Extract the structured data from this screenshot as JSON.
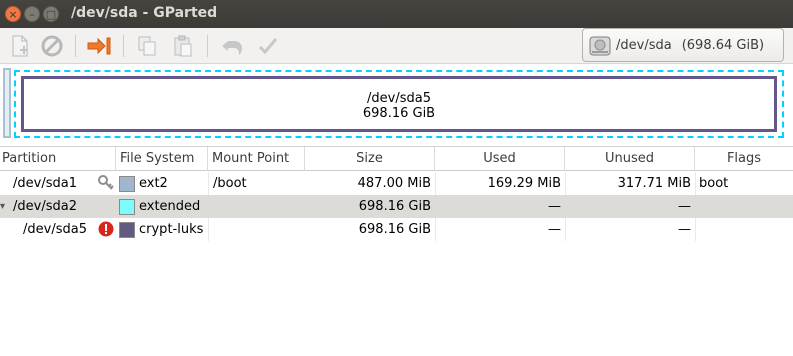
{
  "window": {
    "title": "/dev/sda - GParted"
  },
  "titlebar_buttons": {
    "close": "×",
    "minimize": "–",
    "maximize": "□"
  },
  "toolbar": {
    "icons": [
      "new-partition-icon",
      "delete-icon",
      "resize-move-icon",
      "copy-icon",
      "paste-icon",
      "undo-icon",
      "apply-icon"
    ],
    "device": "/dev/sda",
    "device_size": "(698.64 GiB)"
  },
  "partition_map": {
    "name": "/dev/sda5",
    "size": "698.16 GiB"
  },
  "table": {
    "columns": [
      "Partition",
      "File System",
      "Mount Point",
      "Size",
      "Used",
      "Unused",
      "Flags"
    ],
    "rows": [
      {
        "partition": "/dev/sda1",
        "indicator": "key-icon",
        "fs": "ext2",
        "fs_color": "#9fb6cd",
        "mount": "/boot",
        "size": "487.00 MiB",
        "used": "169.29 MiB",
        "unused": "317.71 MiB",
        "flags": "boot"
      },
      {
        "partition": "/dev/sda2",
        "expander": "▾",
        "fs": "extended",
        "fs_color": "#7dfcfe",
        "mount": "",
        "size": "698.16 GiB",
        "used": "—",
        "unused": "—",
        "flags": "",
        "selected": true
      },
      {
        "partition": "/dev/sda5",
        "indicator": "error-icon",
        "fs": "crypt-luks",
        "fs_color": "#625b81",
        "mount": "",
        "size": "698.16 GiB",
        "used": "—",
        "unused": "—",
        "flags": ""
      }
    ]
  },
  "colors": {
    "titlebar": "#3c3b37",
    "close_button": "#f07746",
    "partition_border": "#64578a",
    "unallocated_dash": "#00d3ff",
    "selected_row": "#dddbd8"
  }
}
